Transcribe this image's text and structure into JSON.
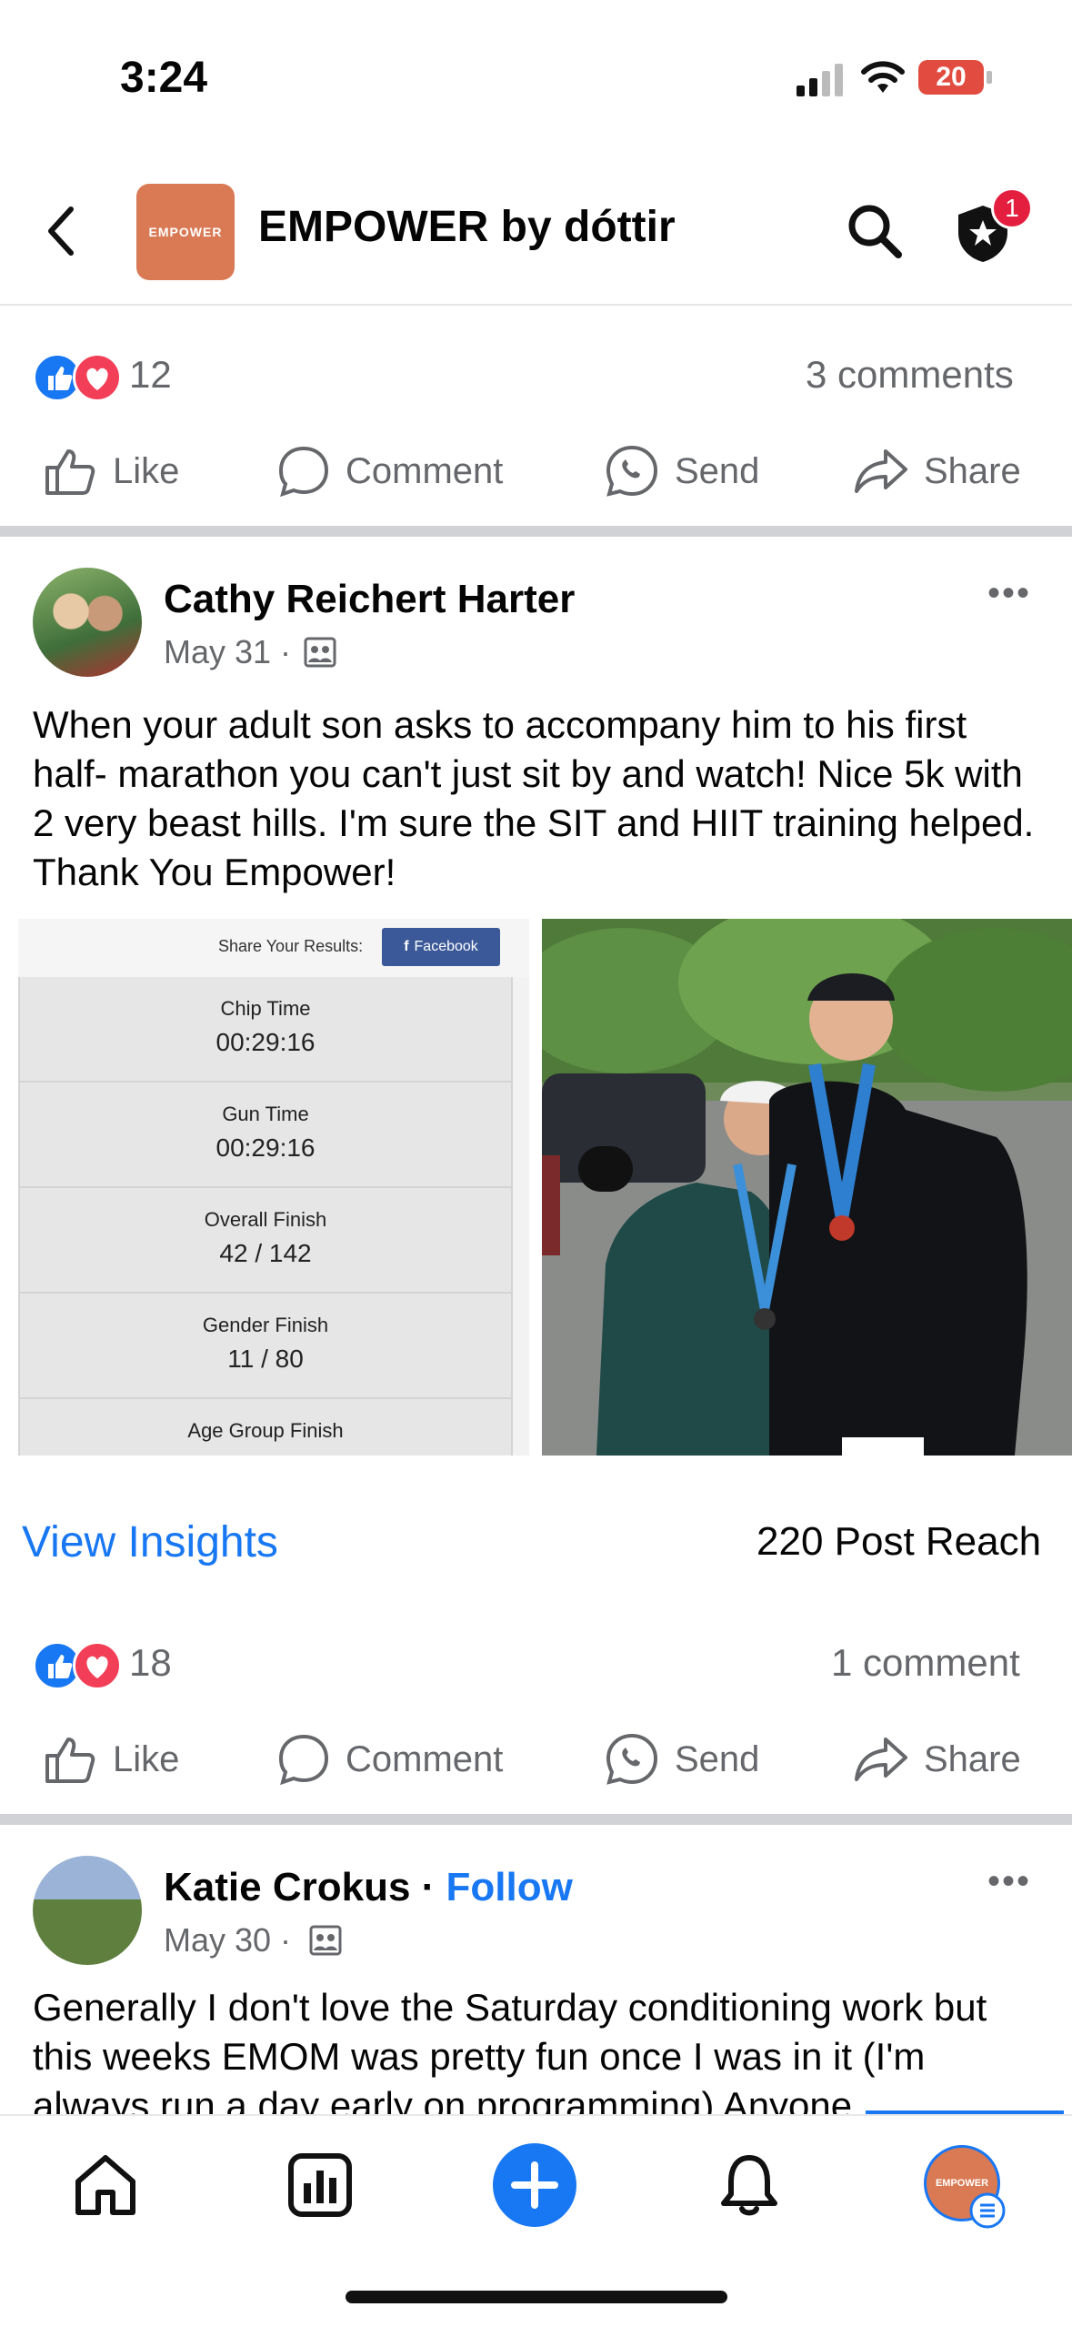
{
  "status_bar": {
    "time": "3:24",
    "battery": "20"
  },
  "header": {
    "page_title": "EMPOWER by dóttir",
    "logo_text": "EMPOWER",
    "notification_count": "1"
  },
  "top_post": {
    "reaction_count": "12",
    "comments": "3 comments"
  },
  "actions": {
    "like": "Like",
    "comment": "Comment",
    "send": "Send",
    "share": "Share"
  },
  "post1": {
    "author": "Cathy Reichert Harter",
    "date": "May 31 ·",
    "text": "When your adult son asks to accompany him to his first half- marathon you can't just sit by and watch! Nice 5k with 2 very beast hills. I'm sure the SIT and HIIT training helped. Thank You Empower!",
    "results": {
      "share_label": "Share Your Results:",
      "facebook_button": "Facebook",
      "rows": [
        {
          "label": "Chip Time",
          "value": "00:29:16"
        },
        {
          "label": "Gun Time",
          "value": "00:29:16"
        },
        {
          "label": "Overall Finish",
          "value": "42 / 142"
        },
        {
          "label": "Gender Finish",
          "value": "11 / 80"
        },
        {
          "label": "Age Group Finish",
          "value": ""
        }
      ]
    },
    "view_insights": "View Insights",
    "post_reach": "220 Post Reach",
    "reaction_count": "18",
    "comments": "1 comment"
  },
  "post2": {
    "author": "Katie Crokus",
    "follow": "Follow",
    "date": "May 30 ·",
    "text": "Generally I don't love the Saturday conditioning work but this weeks EMOM was pretty fun once I was in it (I'm always run a day early on programming) Anyone"
  },
  "tabbar": {
    "profile_logo": "EMPOWER"
  },
  "colors": {
    "accent": "#1877f2",
    "logo": "#d97a55",
    "badge": "#e41e3f"
  }
}
